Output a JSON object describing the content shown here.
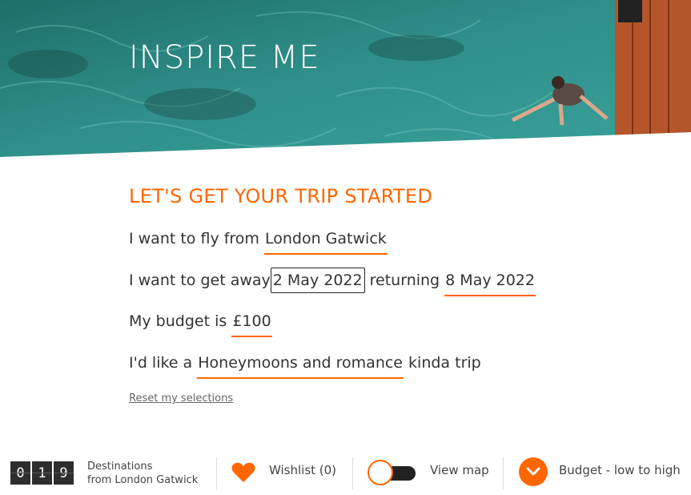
{
  "hero": {
    "title": "INSPIRE ME"
  },
  "form": {
    "heading": "LET'S GET YOUR TRIP STARTED",
    "fly_from": {
      "prefix": "I want to fly from",
      "value": "London Gatwick"
    },
    "dates": {
      "prefix": "I want to get away",
      "depart": "2 May 2022",
      "middle": "returning",
      "return": "8 May 2022"
    },
    "budget": {
      "prefix": "My budget is",
      "value": "£100"
    },
    "trip_type": {
      "prefix": "I'd like a",
      "value": "Honeymoons and romance",
      "suffix": "kinda trip"
    },
    "reset_label": "Reset my selections"
  },
  "bottom_bar": {
    "counter_digits": [
      "0",
      "1",
      "9"
    ],
    "destinations_line1": "Destinations",
    "destinations_line2": "from London Gatwick",
    "wishlist_label": "Wishlist (0)",
    "view_map_label": "View map",
    "sort_label": "Budget - low to high"
  },
  "colors": {
    "accent": "#ff6600",
    "text": "#333333",
    "sea": "#2f8f8a",
    "dock": "#b5562a"
  },
  "icons": {
    "wishlist": "heart-icon",
    "map_toggle": "toggle-switch",
    "sort": "chevron-down-icon"
  }
}
